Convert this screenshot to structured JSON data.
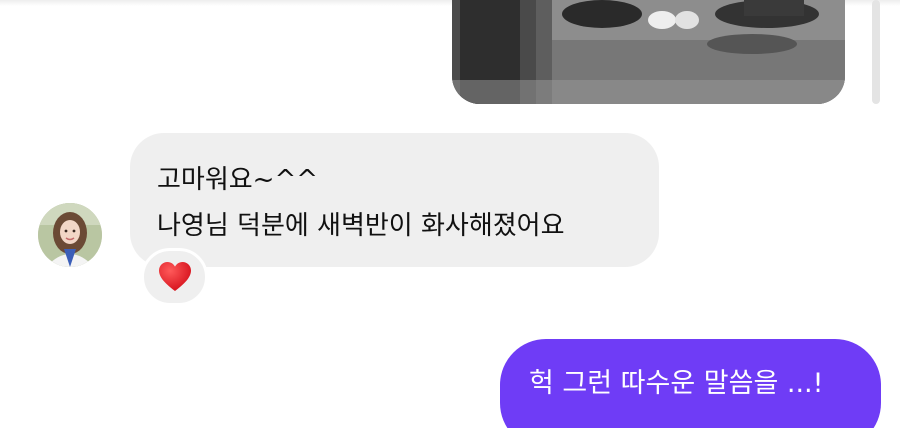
{
  "conversation": {
    "incoming": {
      "line1": "고마워요~^^",
      "line2": "나영님 덕분에 새벽반이 화사해졌어요",
      "reaction_icon": "heart-icon",
      "bubble_color": "#efefef"
    },
    "outgoing": {
      "text": "헉 그런 따수운 말씀을 ...!",
      "bubble_color": "#6f3cf6"
    },
    "shared_photo_icon": "photo-icon",
    "avatar_icon": "profile-photo-icon"
  }
}
